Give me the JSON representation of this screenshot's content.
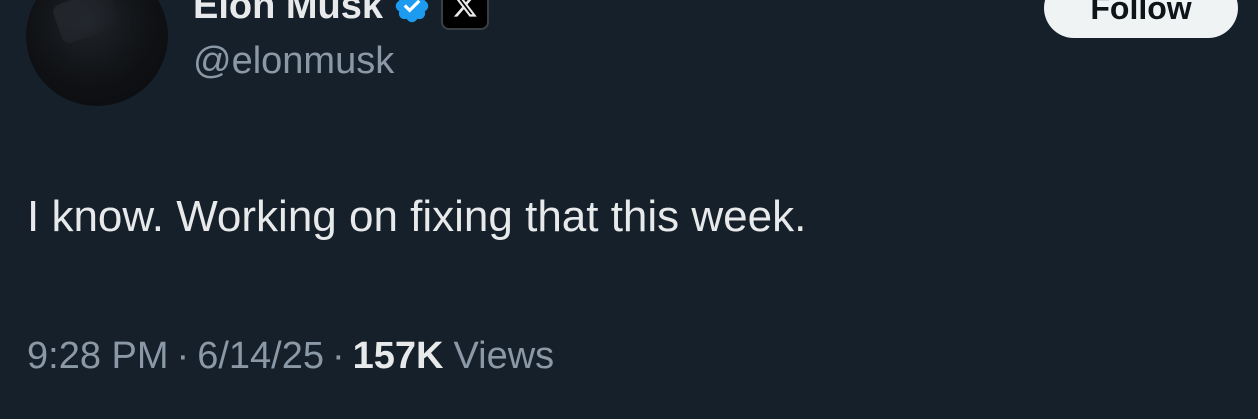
{
  "author": {
    "display_name": "Elon Musk",
    "handle": "@elonmusk",
    "verified_icon": "verified-badge-icon",
    "affiliation_icon": "x-logo-icon"
  },
  "follow_button": {
    "label": "Follow"
  },
  "tweet": {
    "text": "I know. Working on fixing that this week."
  },
  "meta": {
    "time": "9:28 PM",
    "separator": "·",
    "date": "6/14/25",
    "views_count": "157K",
    "views_label": "Views"
  },
  "colors": {
    "background": "#15202b",
    "primary_text": "#e7e9ea",
    "secondary_text": "#8b98a5",
    "verified_blue": "#1d9bf0",
    "button_bg": "#eff3f4"
  }
}
